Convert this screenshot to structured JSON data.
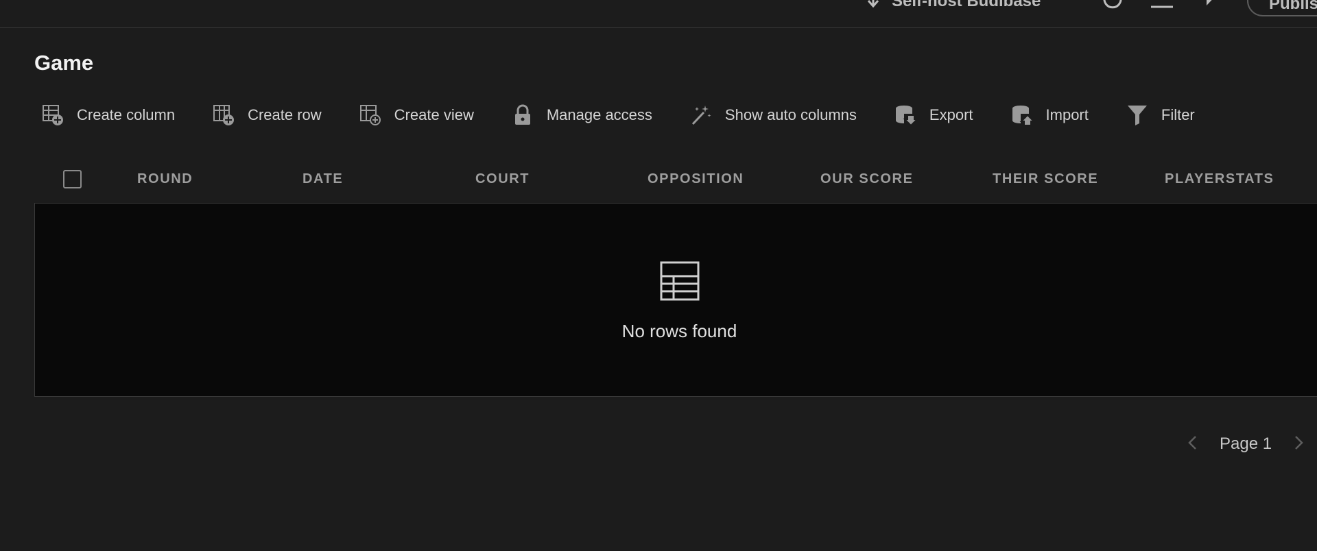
{
  "topbar": {
    "self_host_label": "Self-host Budibase",
    "publish_label": "Publish"
  },
  "page": {
    "title": "Game"
  },
  "toolbar": {
    "create_column": "Create column",
    "create_row": "Create row",
    "create_view": "Create view",
    "manage_access": "Manage access",
    "show_auto_columns": "Show auto columns",
    "export": "Export",
    "import": "Import",
    "filter": "Filter"
  },
  "table": {
    "columns": [
      "ROUND",
      "DATE",
      "COURT",
      "OPPOSITION",
      "OUR SCORE",
      "THEIR SCORE",
      "PLAYERSTATS"
    ],
    "empty_message": "No rows found"
  },
  "pagination": {
    "label": "Page 1"
  },
  "icons": {
    "create_column": "table-add-icon",
    "create_row": "table-add-icon",
    "create_view": "table-add-icon",
    "manage_access": "lock-icon",
    "show_auto_columns": "magic-wand-icon",
    "export": "database-export-icon",
    "import": "database-import-icon",
    "filter": "filter-icon",
    "empty": "table-icon"
  },
  "colors": {
    "background": "#1c1c1c",
    "table_body": "#090909",
    "header_text": "#9e9e9e",
    "title_text": "#f2f2f2"
  }
}
